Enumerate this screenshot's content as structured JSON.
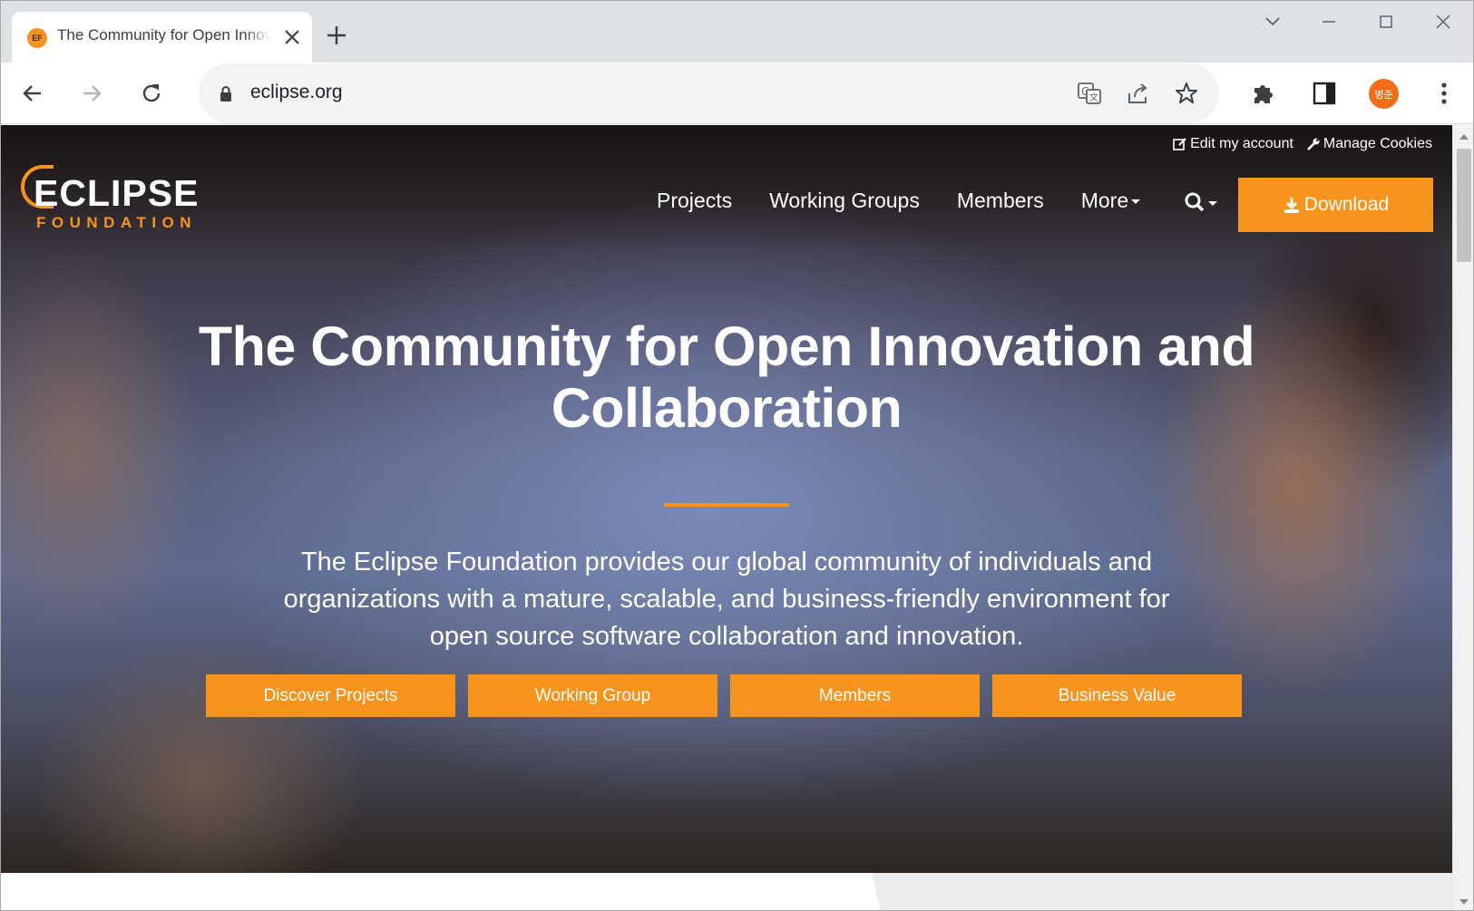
{
  "browser": {
    "tab": {
      "favicon_text": "EF",
      "title": "The Community for Open Innovation and Collaboration"
    },
    "address_bar": {
      "url": "eclipse.org"
    },
    "profile_avatar_text": "병준",
    "icons": [
      "back-icon",
      "forward-icon",
      "reload-icon",
      "lock-icon",
      "translate-icon",
      "share-icon",
      "bookmark-star-icon",
      "extensions-icon",
      "side-panel-icon",
      "menu-icon",
      "close-icon",
      "plus-icon",
      "minimize-icon",
      "maximize-icon",
      "chevron-down-icon"
    ]
  },
  "page": {
    "utility_links": [
      {
        "label": "Edit my account",
        "icon": "edit-icon"
      },
      {
        "label": "Manage Cookies",
        "icon": "wrench-icon"
      }
    ],
    "logo": {
      "main": "ECLIPSE",
      "sub": "FOUNDATION"
    },
    "nav": [
      {
        "label": "Projects"
      },
      {
        "label": "Working Groups"
      },
      {
        "label": "Members"
      },
      {
        "label": "More"
      }
    ],
    "download_label": "Download",
    "headline": "The Community for Open Innovation and Collaboration",
    "description": "The Eclipse Foundation provides our global community of individuals and organizations with a mature, scalable, and business-friendly environment for open source software collaboration and innovation.",
    "cta_buttons": [
      {
        "label": "Discover Projects"
      },
      {
        "label": "Working Group"
      },
      {
        "label": "Members"
      },
      {
        "label": "Business Value"
      }
    ]
  },
  "colors": {
    "accent": "#f7941e",
    "tabstrip": "#dee1e6",
    "omnibox": "#f1f3f4"
  }
}
